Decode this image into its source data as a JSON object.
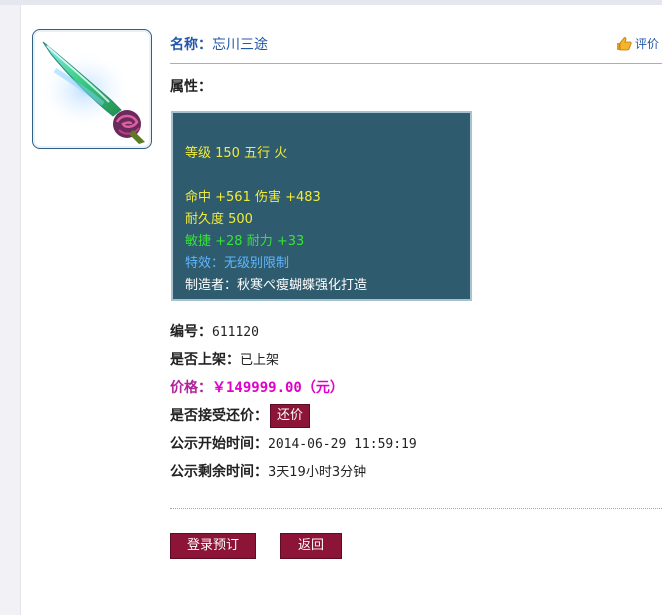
{
  "item": {
    "name_label": "名称：",
    "name_value": "忘川三途",
    "eval_link": "评价",
    "attributes_label": "属性："
  },
  "stats": {
    "level_line": "等级 150 五行 火",
    "hit_damage_line": "命中 +561 伤害 +483",
    "durability_line": "耐久度 500",
    "agility_endurance_line": "敏捷 +28 耐力 +33",
    "effect_line": "特效：无级别限制",
    "maker_line": "制造者：秋寒ぺ瘦蝴蝶强化打造"
  },
  "details": {
    "id_label": "编号：",
    "id_value": "611120",
    "listed_label": "是否上架：",
    "listed_value": "已上架",
    "price_label": "价格：",
    "price_value": "￥149999.00（元）",
    "counter_label": "是否接受还价：",
    "counter_button": "还价",
    "start_label": "公示开始时间：",
    "start_value": "2014-06-29 11:59:19",
    "remain_label": "公示剩余时间：",
    "remain_value": "3天19小时3分钟"
  },
  "actions": {
    "reserve_button": "登录预订",
    "back_button": "返回"
  },
  "colors": {
    "stats_bg": "#2e5b6d",
    "button_bg": "#8b1437",
    "price_color": "#e000c8",
    "link_color": "#2357a8"
  },
  "icons": {
    "item": "weapon-blade-icon",
    "eval": "thumbs-up-icon"
  }
}
